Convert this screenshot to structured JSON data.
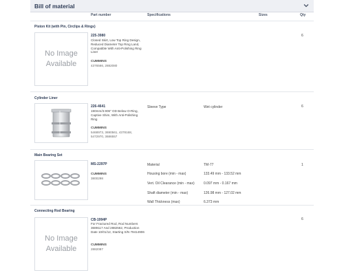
{
  "header": {
    "title": "Bill of material",
    "chevron_icon": "chevron-down-icon"
  },
  "columns": {
    "part_number": "Part number",
    "specifications": "Specifications",
    "sizes": "Sizes",
    "qty": "Qty"
  },
  "sections": [
    {
      "title": "Piston Kit (with Pin, Circlips & Rings)",
      "image_text_1": "No Image",
      "image_text_2": "Available",
      "part_number": "225-3980",
      "description": "Closed Skirt, Low Top Ring Design, Reduced Diameter Top Ring Land, Compatible With Anti-Polishing Ring Liner",
      "brand": "CUMMINS",
      "brand_numbers": "4376566, 2882080",
      "qty": "6"
    },
    {
      "title": "Cylinder Liner",
      "part_number": "226-4641",
      "description": "190mm/3.906\" OD Below O-Ring, Captive Shim, With Anti-Polishing Ring",
      "brand": "CUMMINS",
      "brand_numbers": "5468973, 3690561, 4378168, 5472970, 3686557",
      "spec_label": "Sleeve Type",
      "spec_value": "Wet cylinder",
      "qty": "6"
    },
    {
      "title": "Main Bearing Set",
      "part_number": "MS-2297P",
      "brand": "CUMMINS",
      "brand_numbers": "3800298",
      "specs": [
        {
          "label": "Material",
          "value": "TM-77"
        },
        {
          "label": "Housing bore (min - max)",
          "value": "133.49 mm - 133.52 mm"
        },
        {
          "label": "Vert. Oil Clearance (min - max)",
          "value": "0.097 mm - 0.167 mm"
        },
        {
          "label": "Shaft diameter (min - max)",
          "value": "126.98 mm - 127.02 mm"
        },
        {
          "label": "Wall Thickness (max)",
          "value": "6.373 mm"
        }
      ],
      "qty": "1"
    },
    {
      "title": "Connecting Rod Bearing",
      "image_text_1": "No Image",
      "image_text_2": "Available",
      "part_number": "CB-1994P",
      "description": "For Fractured Rod, Rod Numbers 3689117 And 2882562, Production Date 10/01/12, Starting S/N 79414906",
      "brand": "CUMMINS",
      "brand_numbers": "2882087",
      "qty": "6"
    }
  ]
}
